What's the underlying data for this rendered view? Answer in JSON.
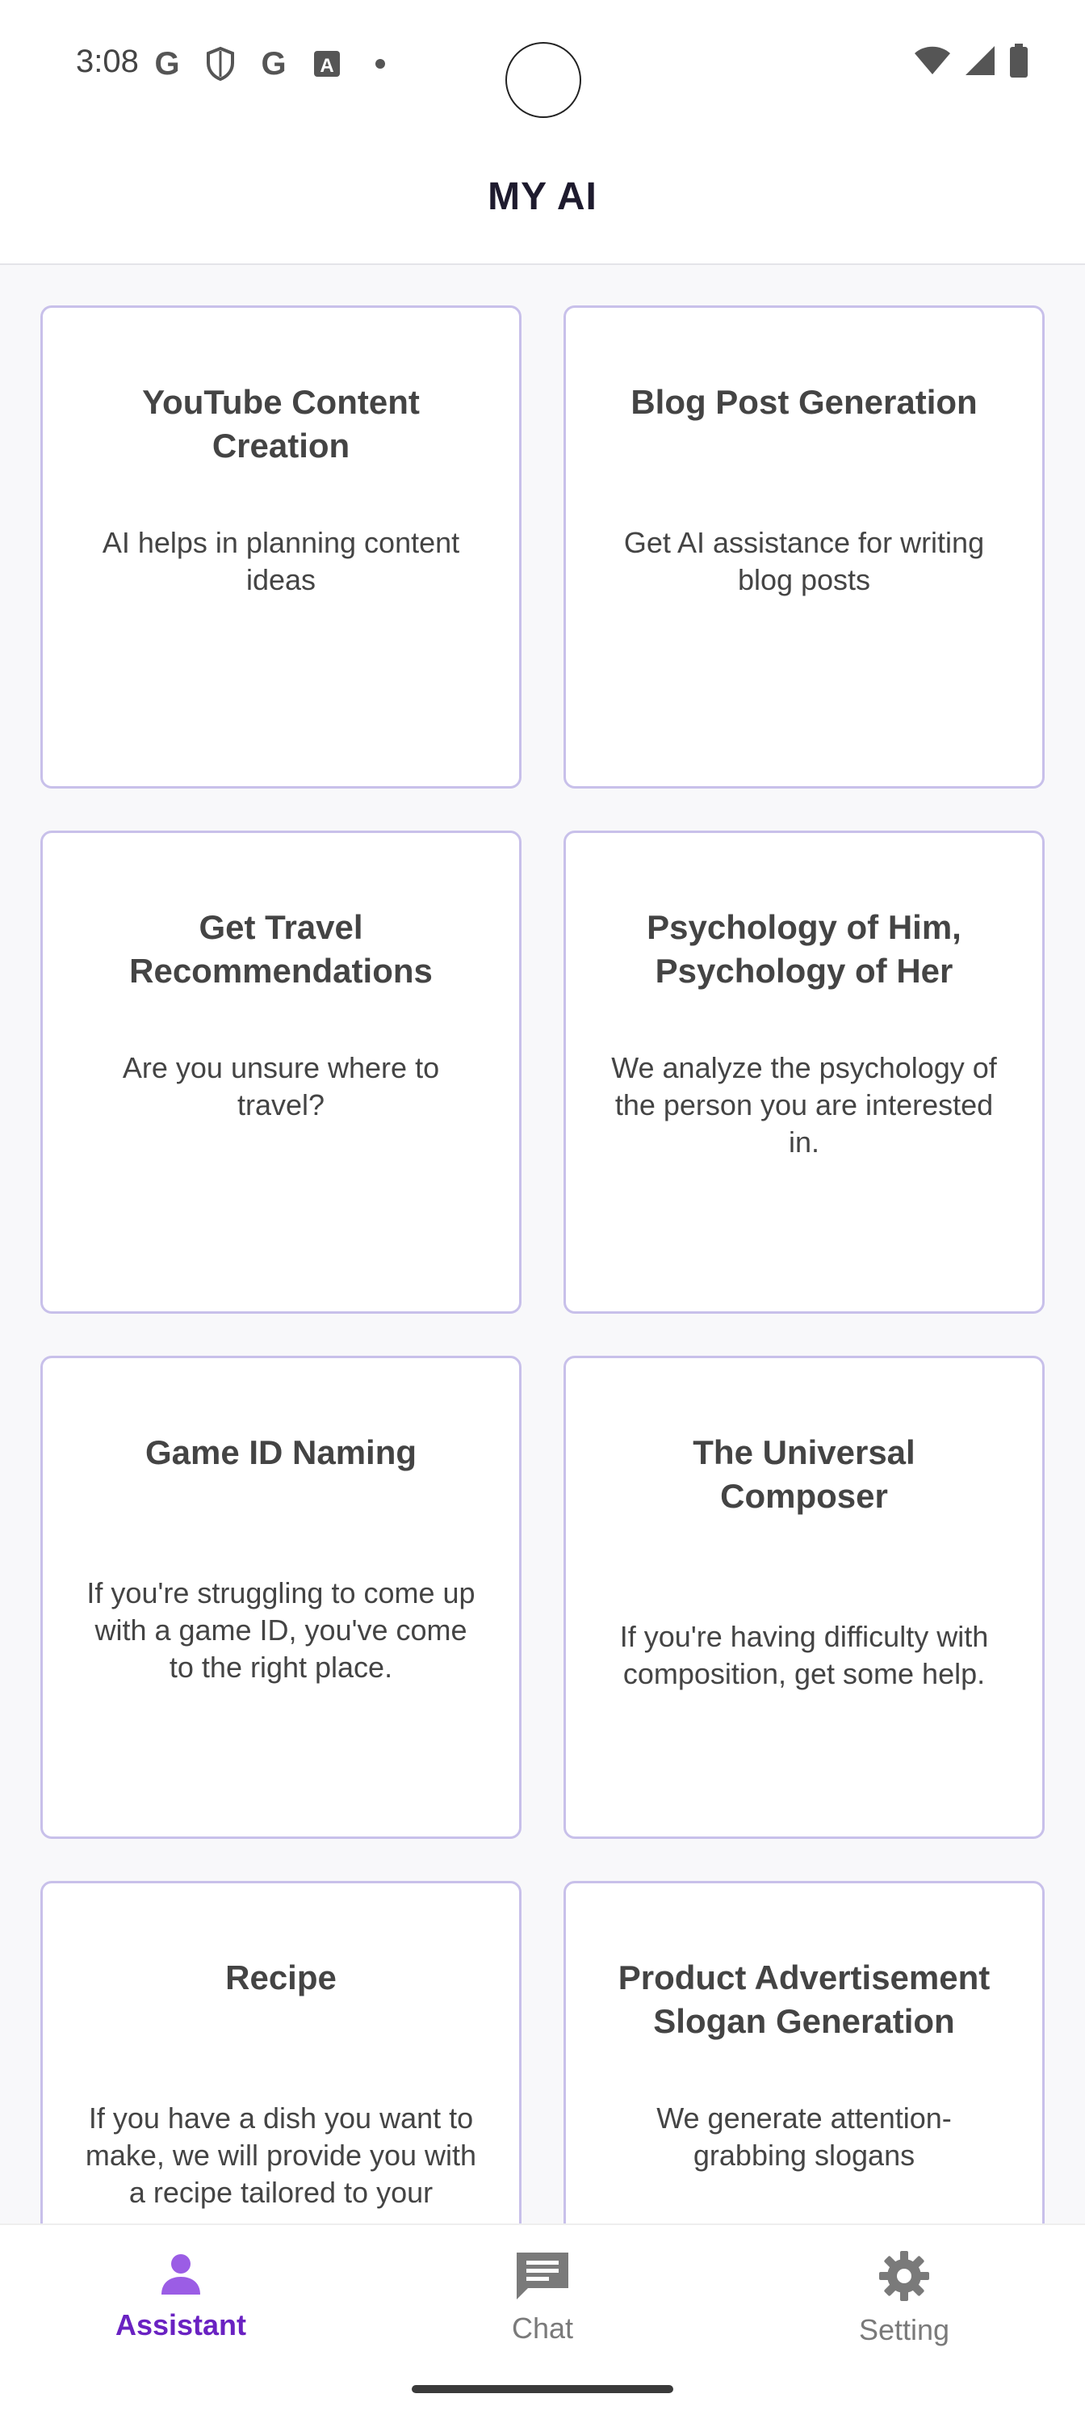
{
  "status_bar": {
    "time": "3:08",
    "left_icons": [
      "google-icon",
      "shield-icon",
      "google-icon",
      "font-icon",
      "dot-icon"
    ],
    "right_icons": [
      "wifi-icon",
      "signal-icon",
      "battery-icon"
    ]
  },
  "app_bar": {
    "title": "MY AI"
  },
  "cards": [
    {
      "title": "YouTube Content Creation",
      "description": "AI helps in planning content ideas"
    },
    {
      "title": "Blog Post Generation",
      "description": "Get AI assistance for writing blog posts"
    },
    {
      "title": "Get Travel Recommendations",
      "description": "Are you unsure where to travel?"
    },
    {
      "title": "Psychology of Him, Psychology of Her",
      "description": "We analyze the psychology of the person you are interested in."
    },
    {
      "title": "Game ID Naming",
      "description": "If you're struggling to come up with a game ID, you've come to the right place."
    },
    {
      "title": "The Universal Composer",
      "description": "If you're having difficulty with composition, get some help."
    },
    {
      "title": "Recipe",
      "description": "If you have a dish you want to make, we will provide you with a recipe tailored to your"
    },
    {
      "title": "Product Advertisement Slogan Generation",
      "description": "We generate attention-grabbing slogans"
    }
  ],
  "bottom_nav": {
    "items": [
      {
        "label": "Assistant",
        "icon": "person-icon",
        "active": true
      },
      {
        "label": "Chat",
        "icon": "chat-icon",
        "active": false
      },
      {
        "label": "Setting",
        "icon": "gear-icon",
        "active": false
      }
    ]
  },
  "colors": {
    "accent": "#6a22c2",
    "accent_icon": "#9b5de5",
    "card_border": "#c8c0ea",
    "text": "#444444",
    "background": "#f8f8fa"
  }
}
